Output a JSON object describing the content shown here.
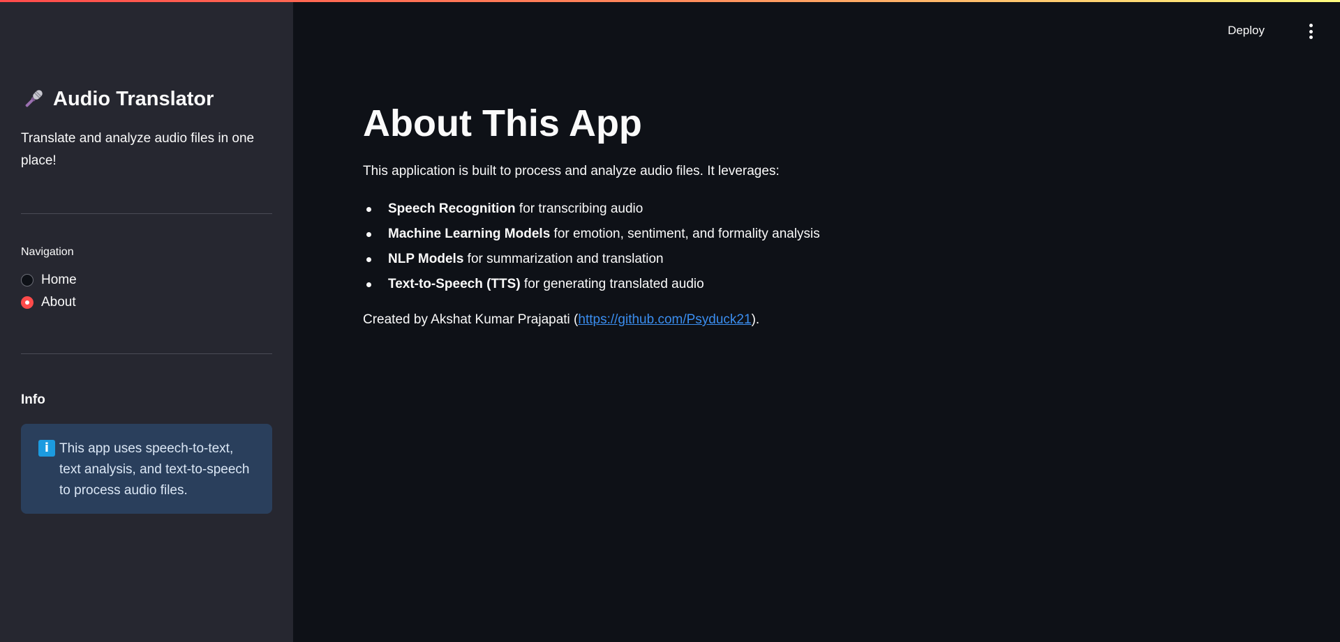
{
  "sidebar": {
    "title": "Audio Translator",
    "title_icon": "microphone-icon",
    "subtitle": "Translate and analyze audio files in one place!",
    "navigation": {
      "label": "Navigation",
      "options": [
        {
          "label": "Home",
          "selected": false
        },
        {
          "label": "About",
          "selected": true
        }
      ]
    },
    "info": {
      "heading": "Info",
      "icon": "info-icon",
      "icon_glyph": "i",
      "text": "This app uses speech-to-text, text analysis, and text-to-speech to process audio files."
    }
  },
  "header": {
    "deploy_label": "Deploy",
    "menu_icon": "more-vertical-icon"
  },
  "main": {
    "title": "About This App",
    "intro": "This application is built to process and analyze audio files. It leverages:",
    "features": [
      {
        "bold": "Speech Recognition",
        "rest": " for transcribing audio"
      },
      {
        "bold": "Machine Learning Models",
        "rest": " for emotion, sentiment, and formality analysis"
      },
      {
        "bold": "NLP Models",
        "rest": " for summarization and translation"
      },
      {
        "bold": "Text-to-Speech (TTS)",
        "rest": " for generating translated audio"
      }
    ],
    "credit": {
      "prefix": "Created by Akshat Kumar Prajapati (",
      "link_text": "https://github.com/Psyduck21",
      "suffix": ")."
    }
  },
  "colors": {
    "accent": "#ff4b4b",
    "link": "#3b8ef0",
    "sidebar_bg": "#262730",
    "main_bg": "#0e1117",
    "info_bg": "#2a3f5c"
  }
}
